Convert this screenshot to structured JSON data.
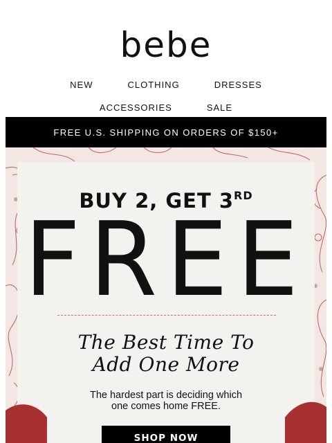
{
  "brand": {
    "logo_text": "bebe"
  },
  "nav": {
    "row1": [
      "NEW",
      "CLOTHING",
      "DRESSES"
    ],
    "row2": [
      "ACCESSORIES",
      "SALE"
    ]
  },
  "promo_bar": {
    "text": "FREE U.S. SHIPPING ON ORDERS OF $150+"
  },
  "hero": {
    "headline": "BUY 2, GET 3",
    "headline_sup": "RD",
    "big_word": "FREE",
    "script_line1": "The Best Time To",
    "script_line2": "Add One More",
    "body_line1": "The hardest part is deciding which",
    "body_line2": "one comes home FREE.",
    "cta": "SHOP NOW"
  },
  "colors": {
    "accent_red": "#a83032",
    "pattern_red": "#b55459",
    "divider": "#d86a74",
    "card_bg": "#f3f2ee",
    "bar_bg": "#000000"
  }
}
